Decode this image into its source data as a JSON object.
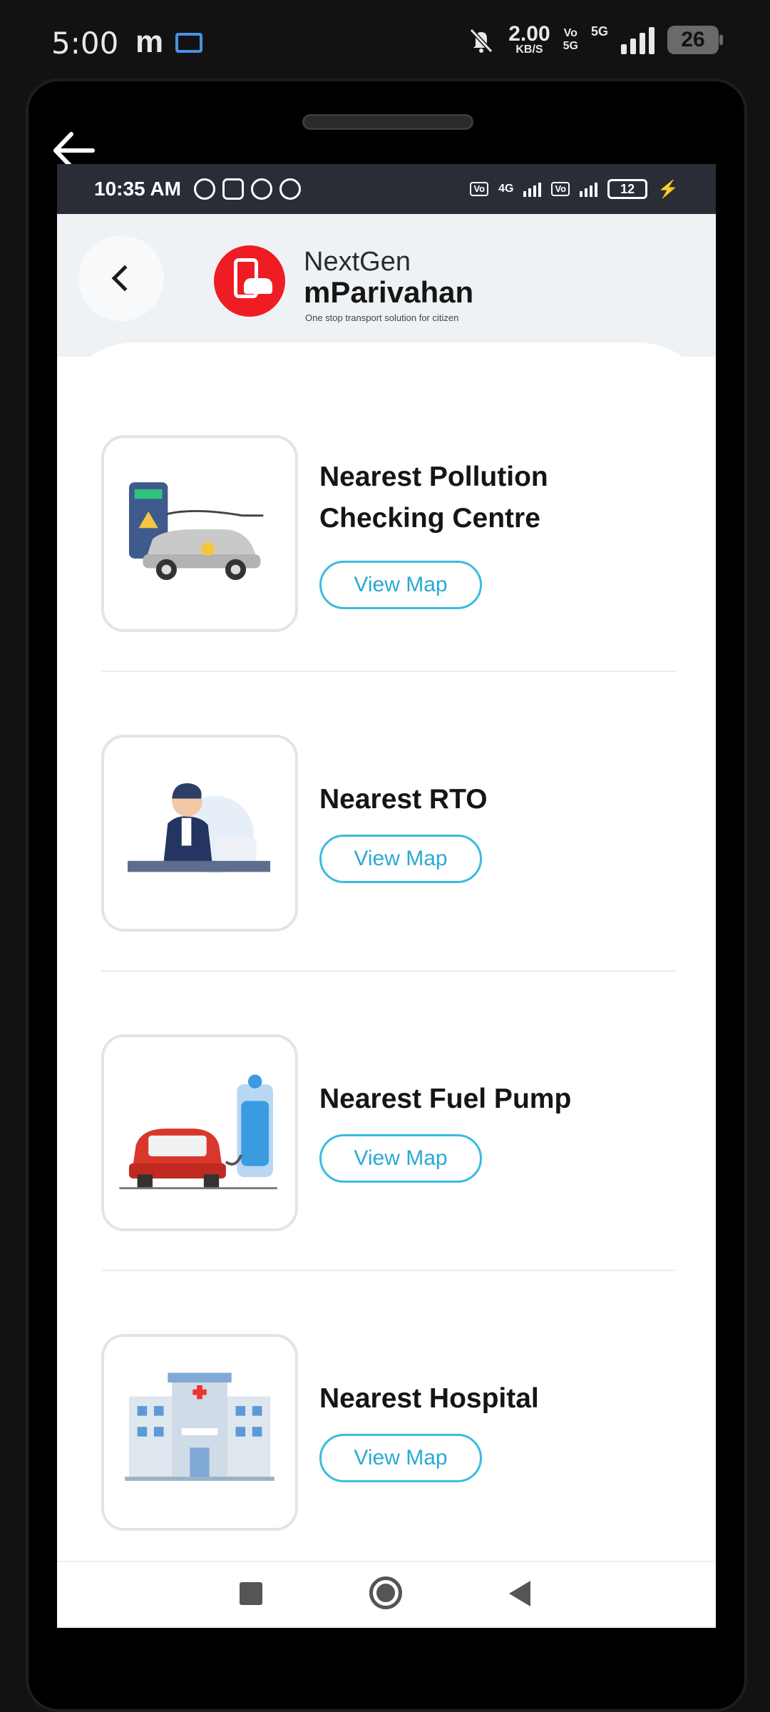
{
  "device_status": {
    "time": "5:00",
    "app_letter": "m",
    "speed_value": "2.00",
    "speed_unit": "KB/S",
    "volte_label": "Vo\n5G",
    "network_label": "5G",
    "battery_level": "26"
  },
  "inner_status": {
    "time": "10:35 AM",
    "net_label": "4G",
    "volte_label": "Vo LTE",
    "battery_level": "12"
  },
  "header": {
    "brand_top": "NextGen",
    "brand_main": "mParivahan",
    "brand_tagline": "One stop transport solution for citizen"
  },
  "entries": [
    {
      "title_line1": "Nearest Pollution",
      "title_line2": "Checking Centre",
      "button_label": "View Map"
    },
    {
      "title_line1": "Nearest RTO",
      "button_label": "View Map"
    },
    {
      "title_line1": "Nearest Fuel Pump",
      "button_label": "View Map"
    },
    {
      "title_line1": "Nearest Hospital",
      "button_label": "View Map"
    }
  ],
  "colors": {
    "brand_red": "#ef1c24",
    "accent_cyan": "#3bbbe0",
    "header_bg": "#eef2f4"
  }
}
